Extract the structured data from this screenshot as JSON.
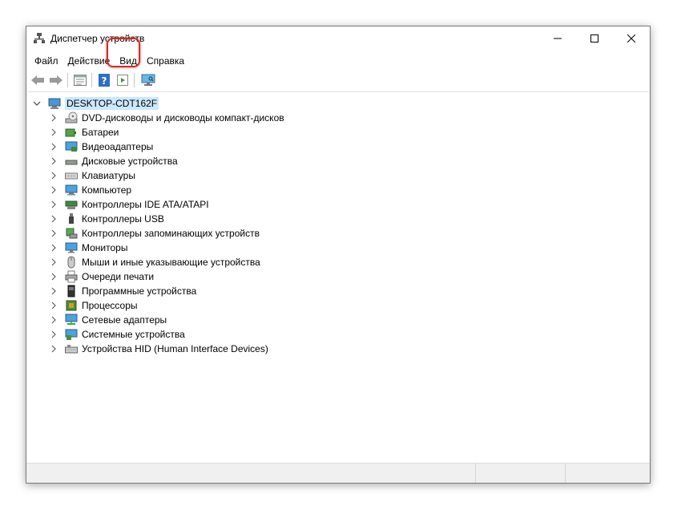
{
  "window": {
    "title": "Диспетчер устройств",
    "app_icon": "device-manager-icon"
  },
  "window_controls": [
    "minimize",
    "maximize",
    "close"
  ],
  "menu": [
    "Файл",
    "Действие",
    "Вид",
    "Справка"
  ],
  "toolbar": {
    "buttons": [
      "back",
      "forward",
      "properties",
      "help",
      "run",
      "scan-hardware"
    ],
    "highlighted": "scan-hardware",
    "highlight_color": "#d22b2b"
  },
  "tree": {
    "root": {
      "label": "DESKTOP-CDT162F",
      "icon": "computer-root-icon",
      "expanded": true
    },
    "items": [
      {
        "label": "DVD-дисководы и дисководы компакт-дисков",
        "icon": "dvd-drive-icon"
      },
      {
        "label": "Батареи",
        "icon": "battery-icon"
      },
      {
        "label": "Видеоадаптеры",
        "icon": "display-adapter-icon"
      },
      {
        "label": "Дисковые устройства",
        "icon": "disk-drive-icon"
      },
      {
        "label": "Клавиатуры",
        "icon": "keyboard-icon"
      },
      {
        "label": "Компьютер",
        "icon": "computer-icon"
      },
      {
        "label": "Контроллеры IDE ATA/ATAPI",
        "icon": "ide-controller-icon"
      },
      {
        "label": "Контроллеры USB",
        "icon": "usb-icon"
      },
      {
        "label": "Контроллеры запоминающих устройств",
        "icon": "storage-controller-icon"
      },
      {
        "label": "Мониторы",
        "icon": "monitor-icon"
      },
      {
        "label": "Мыши и иные указывающие устройства",
        "icon": "mouse-icon"
      },
      {
        "label": "Очереди печати",
        "icon": "printer-icon"
      },
      {
        "label": "Программные устройства",
        "icon": "software-device-icon"
      },
      {
        "label": "Процессоры",
        "icon": "processor-icon"
      },
      {
        "label": "Сетевые адаптеры",
        "icon": "network-adapter-icon"
      },
      {
        "label": "Системные устройства",
        "icon": "system-device-icon"
      },
      {
        "label": "Устройства HID (Human Interface Devices)",
        "icon": "hid-icon"
      }
    ]
  },
  "colors": {
    "selection": "#cce8ff",
    "accent": "#2e8ad8"
  }
}
